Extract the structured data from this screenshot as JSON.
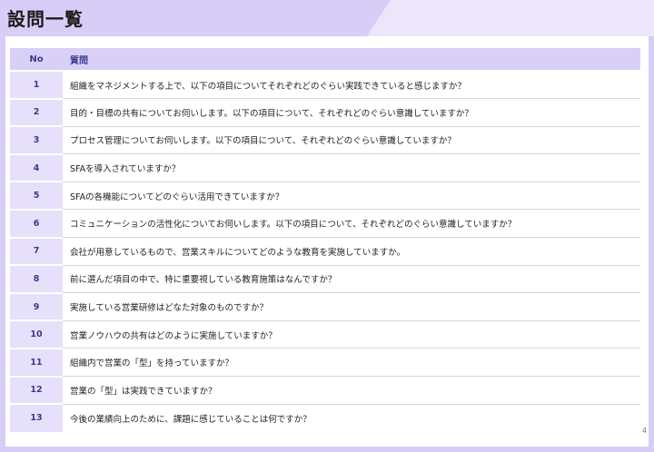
{
  "header": {
    "title": "設問一覧"
  },
  "table": {
    "col_no": "No",
    "col_question": "質問",
    "rows": [
      {
        "no": "1",
        "q": "組織をマネジメントする上で、以下の項目についてそれぞれどのぐらい実践できていると感じますか？"
      },
      {
        "no": "2",
        "q": "目的・目標の共有についてお伺いします。以下の項目について、それぞれどのぐらい意識していますか？"
      },
      {
        "no": "3",
        "q": "プロセス管理についてお伺いします。以下の項目について、それぞれどのぐらい意識していますか？"
      },
      {
        "no": "4",
        "q": "SFAを導入されていますか？"
      },
      {
        "no": "5",
        "q": "SFAの各機能についてどのぐらい活用できていますか？"
      },
      {
        "no": "6",
        "q": "コミュニケーションの活性化についてお伺いします。以下の項目について、それぞれどのぐらい意識していますか？"
      },
      {
        "no": "7",
        "q": "会社が用意しているもので、営業スキルについてどのような教育を実施していますか。"
      },
      {
        "no": "8",
        "q": "前に選んだ項目の中で、特に重要視している教育施策はなんですか？"
      },
      {
        "no": "9",
        "q": "実施している営業研修はどなた対象のものですか？"
      },
      {
        "no": "10",
        "q": "営業ノウハウの共有はどのように実施していますか？"
      },
      {
        "no": "11",
        "q": "組織内で営業の「型」を持っていますか？"
      },
      {
        "no": "12",
        "q": "営業の「型」は実践できていますか？"
      },
      {
        "no": "13",
        "q": "今後の業績向上のために、課題に感じていることは何ですか？"
      }
    ]
  },
  "footer": {
    "page_number": "4"
  },
  "colors": {
    "accent": "#d9d0f7",
    "accent_dark": "#3b3b8f",
    "frame": "#d8cdf6"
  }
}
